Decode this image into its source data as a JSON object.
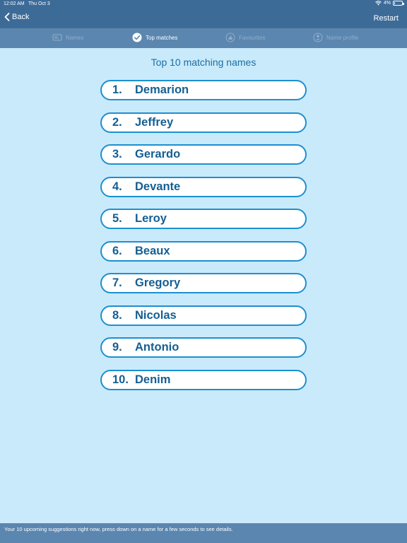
{
  "status_bar": {
    "time": "12:02 AM",
    "date": "Thu Oct 3",
    "battery": "4%"
  },
  "nav": {
    "back_label": "Back",
    "restart_label": "Restart"
  },
  "tabs": [
    {
      "label": "Names",
      "icon": "id-card-icon",
      "active": false
    },
    {
      "label": "Top matches",
      "icon": "checkmark-icon",
      "active": true
    },
    {
      "label": "Favourites",
      "icon": "thumbs-up-icon",
      "active": false
    },
    {
      "label": "Name profile",
      "icon": "person-icon",
      "active": false
    }
  ],
  "title": "Top 10 matching names",
  "names": [
    {
      "rank": "1.",
      "name": "Demarion"
    },
    {
      "rank": "2.",
      "name": "Jeffrey"
    },
    {
      "rank": "3.",
      "name": "Gerardo"
    },
    {
      "rank": "4.",
      "name": "Devante"
    },
    {
      "rank": "5.",
      "name": "Leroy"
    },
    {
      "rank": "6.",
      "name": "Beaux"
    },
    {
      "rank": "7.",
      "name": "Gregory"
    },
    {
      "rank": "8.",
      "name": "Nicolas"
    },
    {
      "rank": "9.",
      "name": "Antonio"
    },
    {
      "rank": "10.",
      "name": "Denim"
    }
  ],
  "footer": "Your 10 upcoming suggestions right now, press down on a name for a few seconds to see details.",
  "colors": {
    "nav": "#3d6b98",
    "tab_bar": "#5b86af",
    "background": "#c9eafb",
    "accent": "#1d8fd0",
    "text": "#145f93"
  }
}
